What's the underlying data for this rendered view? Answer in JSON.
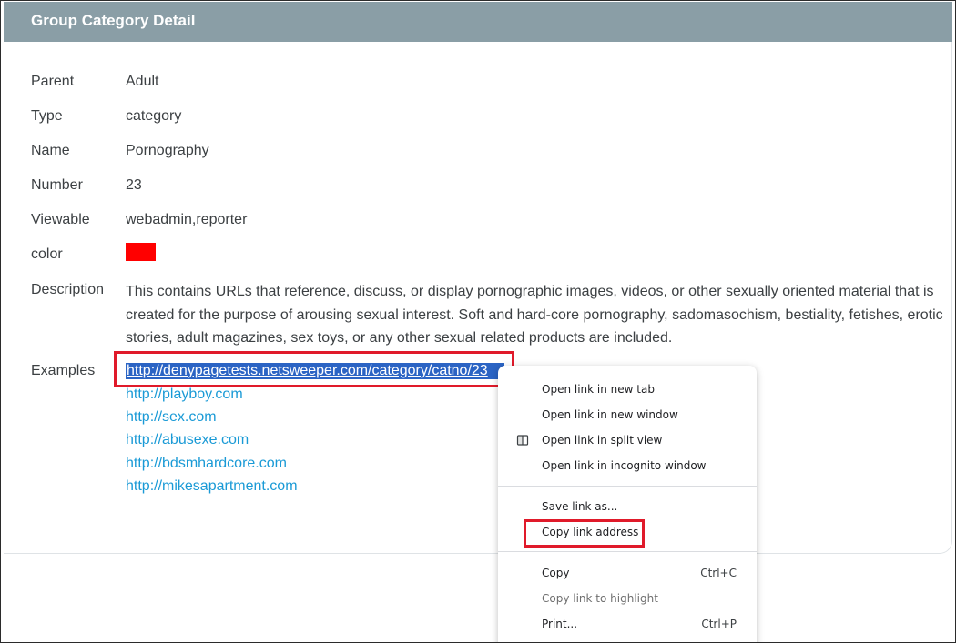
{
  "card": {
    "title": "Group Category Detail"
  },
  "details": {
    "parent": {
      "label": "Parent",
      "value": "Adult"
    },
    "type": {
      "label": "Type",
      "value": "category"
    },
    "name": {
      "label": "Name",
      "value": "Pornography"
    },
    "number": {
      "label": "Number",
      "value": "23"
    },
    "viewable": {
      "label": "Viewable",
      "value": "webadmin,reporter"
    },
    "color": {
      "label": "color",
      "swatch": "#ff0000"
    },
    "description": {
      "label": "Description",
      "value": "This contains URLs that reference, discuss, or display pornographic images, videos, or other sexually oriented material that is created for the purpose of arousing sexual interest. Soft and hard-core pornography, sadomasochism, bestiality, fetishes, erotic stories, adult magazines, sex toys, or any other sexual related products are included."
    },
    "examples": {
      "label": "Examples",
      "links": [
        "http://denypagetests.netsweeper.com/category/catno/23",
        "http://playboy.com",
        "http://sex.com",
        "http://abusexe.com",
        "http://bdsmhardcore.com",
        "http://mikesapartment.com"
      ]
    }
  },
  "context_menu": {
    "items": [
      {
        "label": "Open link in new tab"
      },
      {
        "label": "Open link in new window"
      },
      {
        "label": "Open link in split view",
        "icon": "split-view-icon"
      },
      {
        "label": "Open link in incognito window"
      },
      {
        "label": "Save link as..."
      },
      {
        "label": "Copy link address"
      },
      {
        "label": "Copy",
        "shortcut": "Ctrl+C"
      },
      {
        "label": "Copy link to highlight"
      },
      {
        "label": "Print...",
        "shortcut": "Ctrl+P"
      }
    ]
  },
  "colors": {
    "header_bg": "#8a9ea6",
    "link": "#1a9ad6",
    "selection": "#2b64c4",
    "annotation": "#e01a2a"
  }
}
